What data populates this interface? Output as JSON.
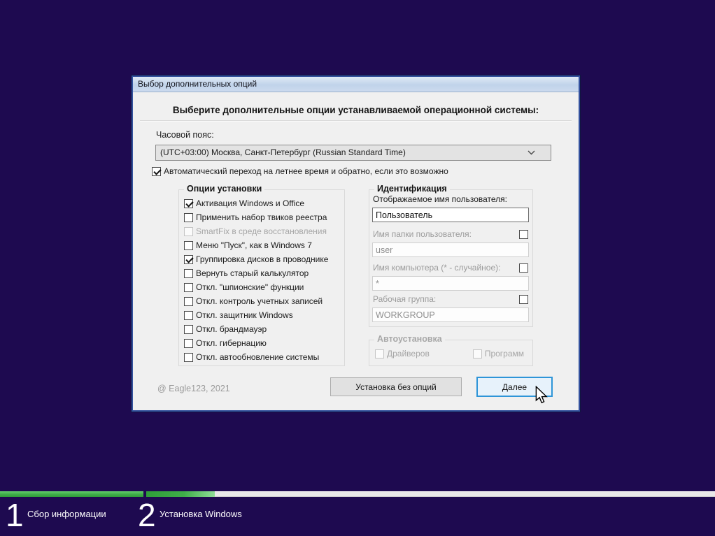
{
  "window": {
    "title": "Выбор дополнительных опций",
    "heading": "Выберите дополнительные опции устанавливаемой операционной системы:"
  },
  "timezone": {
    "label": "Часовой пояс:",
    "value": "(UTC+03:00) Москва, Санкт-Петербург (Russian Standard Time)"
  },
  "dst_checkbox": {
    "label": "Автоматический переход на летнее время и обратно, если это возможно",
    "checked": true
  },
  "options_group": {
    "title": "Опции установки",
    "items": [
      {
        "label": "Активация Windows и Office",
        "checked": true,
        "disabled": false
      },
      {
        "label": "Применить набор твиков реестра",
        "checked": false,
        "disabled": false
      },
      {
        "label": "SmartFix в среде восстановления",
        "checked": false,
        "disabled": true
      },
      {
        "label": "Меню \"Пуск\", как в Windows 7",
        "checked": false,
        "disabled": false
      },
      {
        "label": "Группировка дисков в проводнике",
        "checked": true,
        "disabled": false
      },
      {
        "label": "Вернуть старый калькулятор",
        "checked": false,
        "disabled": false
      },
      {
        "label": "Откл. \"шпионские\" функции",
        "checked": false,
        "disabled": false
      },
      {
        "label": "Откл. контроль учетных записей",
        "checked": false,
        "disabled": false
      },
      {
        "label": "Откл. защитник Windows",
        "checked": false,
        "disabled": false
      },
      {
        "label": "Откл. брандмауэр",
        "checked": false,
        "disabled": false
      },
      {
        "label": "Откл. гибернацию",
        "checked": false,
        "disabled": false
      },
      {
        "label": "Откл. автообновление системы",
        "checked": false,
        "disabled": false
      }
    ]
  },
  "identification_group": {
    "title": "Идентификация",
    "fields": [
      {
        "label": "Отображаемое имя пользователя:",
        "value": "Пользователь",
        "disabled": false,
        "has_checkbox": false,
        "checkbox_checked": false
      },
      {
        "label": "Имя папки пользователя:",
        "value": "user",
        "disabled": true,
        "has_checkbox": true,
        "checkbox_checked": false
      },
      {
        "label": "Имя компьютера (* - случайное):",
        "value": "*",
        "disabled": true,
        "has_checkbox": true,
        "checkbox_checked": false
      },
      {
        "label": "Рабочая группа:",
        "value": "WORKGROUP",
        "disabled": true,
        "has_checkbox": true,
        "checkbox_checked": false
      }
    ]
  },
  "autoinstall_group": {
    "title": "Автоустановка",
    "items": [
      {
        "label": "Драйверов",
        "checked": false,
        "disabled": true
      },
      {
        "label": "Программ",
        "checked": false,
        "disabled": true
      }
    ]
  },
  "footer": {
    "credit": "@ Eagle123, 2021",
    "install_no_options_label": "Установка без опций",
    "next_label": "Далее"
  },
  "progress": {
    "steps": [
      {
        "number": "1",
        "label": "Сбор информации",
        "fill_percent": 100
      },
      {
        "number": "2",
        "label": "Установка Windows",
        "fill_percent": 12
      }
    ]
  },
  "colors": {
    "background": "#1e0a50",
    "progress_green": "#3fae49",
    "accent_blue": "#2e95d8",
    "dialog_bg": "#f0f0f0"
  }
}
